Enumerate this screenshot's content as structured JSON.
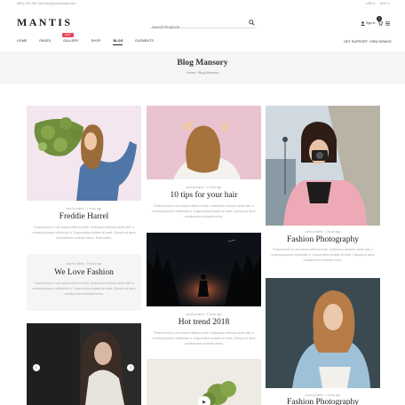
{
  "topbar": {
    "contact": "(800) 123 456 789     info@yourdomain.com",
    "language": "USD  ▾",
    "currency": "ENG  ▾"
  },
  "header": {
    "logo": "MANTIS",
    "search_placeholder": "Search Products",
    "signin": "Sign in",
    "cart_count": "0"
  },
  "nav": {
    "items": [
      "Home",
      "Pages",
      "Gallery",
      "Shop",
      "Blog",
      "Elements"
    ],
    "hot_badge": "Hot",
    "right": [
      "Get Support",
      "View Demos"
    ]
  },
  "banner": {
    "title": "Blog Mansory",
    "breadcrumb": "Home  /  Blog Mansory"
  },
  "posts": [
    {
      "meta": "post by Admin · 3 hours ago",
      "title": "Freddie Harrel",
      "excerpt": "Praesent sed ex vel mauris eleifend mollis. Vestibulum vehicula mollis velit, a consequat ipsum sollicitudin in. Suspendisse sodales sit amet. Quisque at lacus condimentum molestie metus. Nulla facilisi."
    },
    {
      "meta": "post by Admin · 3 hours ago",
      "title": "We Love Fashion",
      "excerpt": "Praesent sed ex vel mauris eleifend mollis. Vestibulum vehicula mollis velit, a consequat ipsum sollicitudin in. Suspendisse sodales sit amet. Quisque at lacus condimentum molestie metus."
    },
    {
      "meta": "post by Admin · 3 hours ago",
      "title": "10 tips for your hair",
      "excerpt": "Praesent sed ex vel mauris eleifend mollis. Vestibulum vehicula mollis velit, a consequat ipsum sollicitudin in. Suspendisse sodales sit amet. Quisque at lacus condimentum molestie metus."
    },
    {
      "meta": "post by Admin · 3 hours ago",
      "title": "Hot trend 2018",
      "excerpt": "Praesent sed ex vel mauris eleifend mollis. Vestibulum vehicula mollis velit, a consequat ipsum sollicitudin in. Suspendisse sodales sit amet. Quisque at lacus condimentum molestie metus."
    },
    {
      "meta": "post by Admin · 3 hours ago",
      "title": "Fashion Photography",
      "excerpt": "Praesent sed ex vel mauris eleifend mollis. Vestibulum vehicula mollis velit, a consequat ipsum sollicitudin in. Suspendisse sodales sit amet. Quisque at lacus condimentum molestie metus."
    },
    {
      "meta": "post by Admin · 3 hours ago",
      "title": "Fashion Photography"
    }
  ],
  "slider": {
    "prev": "‹",
    "next": "›"
  },
  "colors": {
    "hot": "#e8465b",
    "banner_bg": "#f5f5f5",
    "text": "#333333"
  }
}
